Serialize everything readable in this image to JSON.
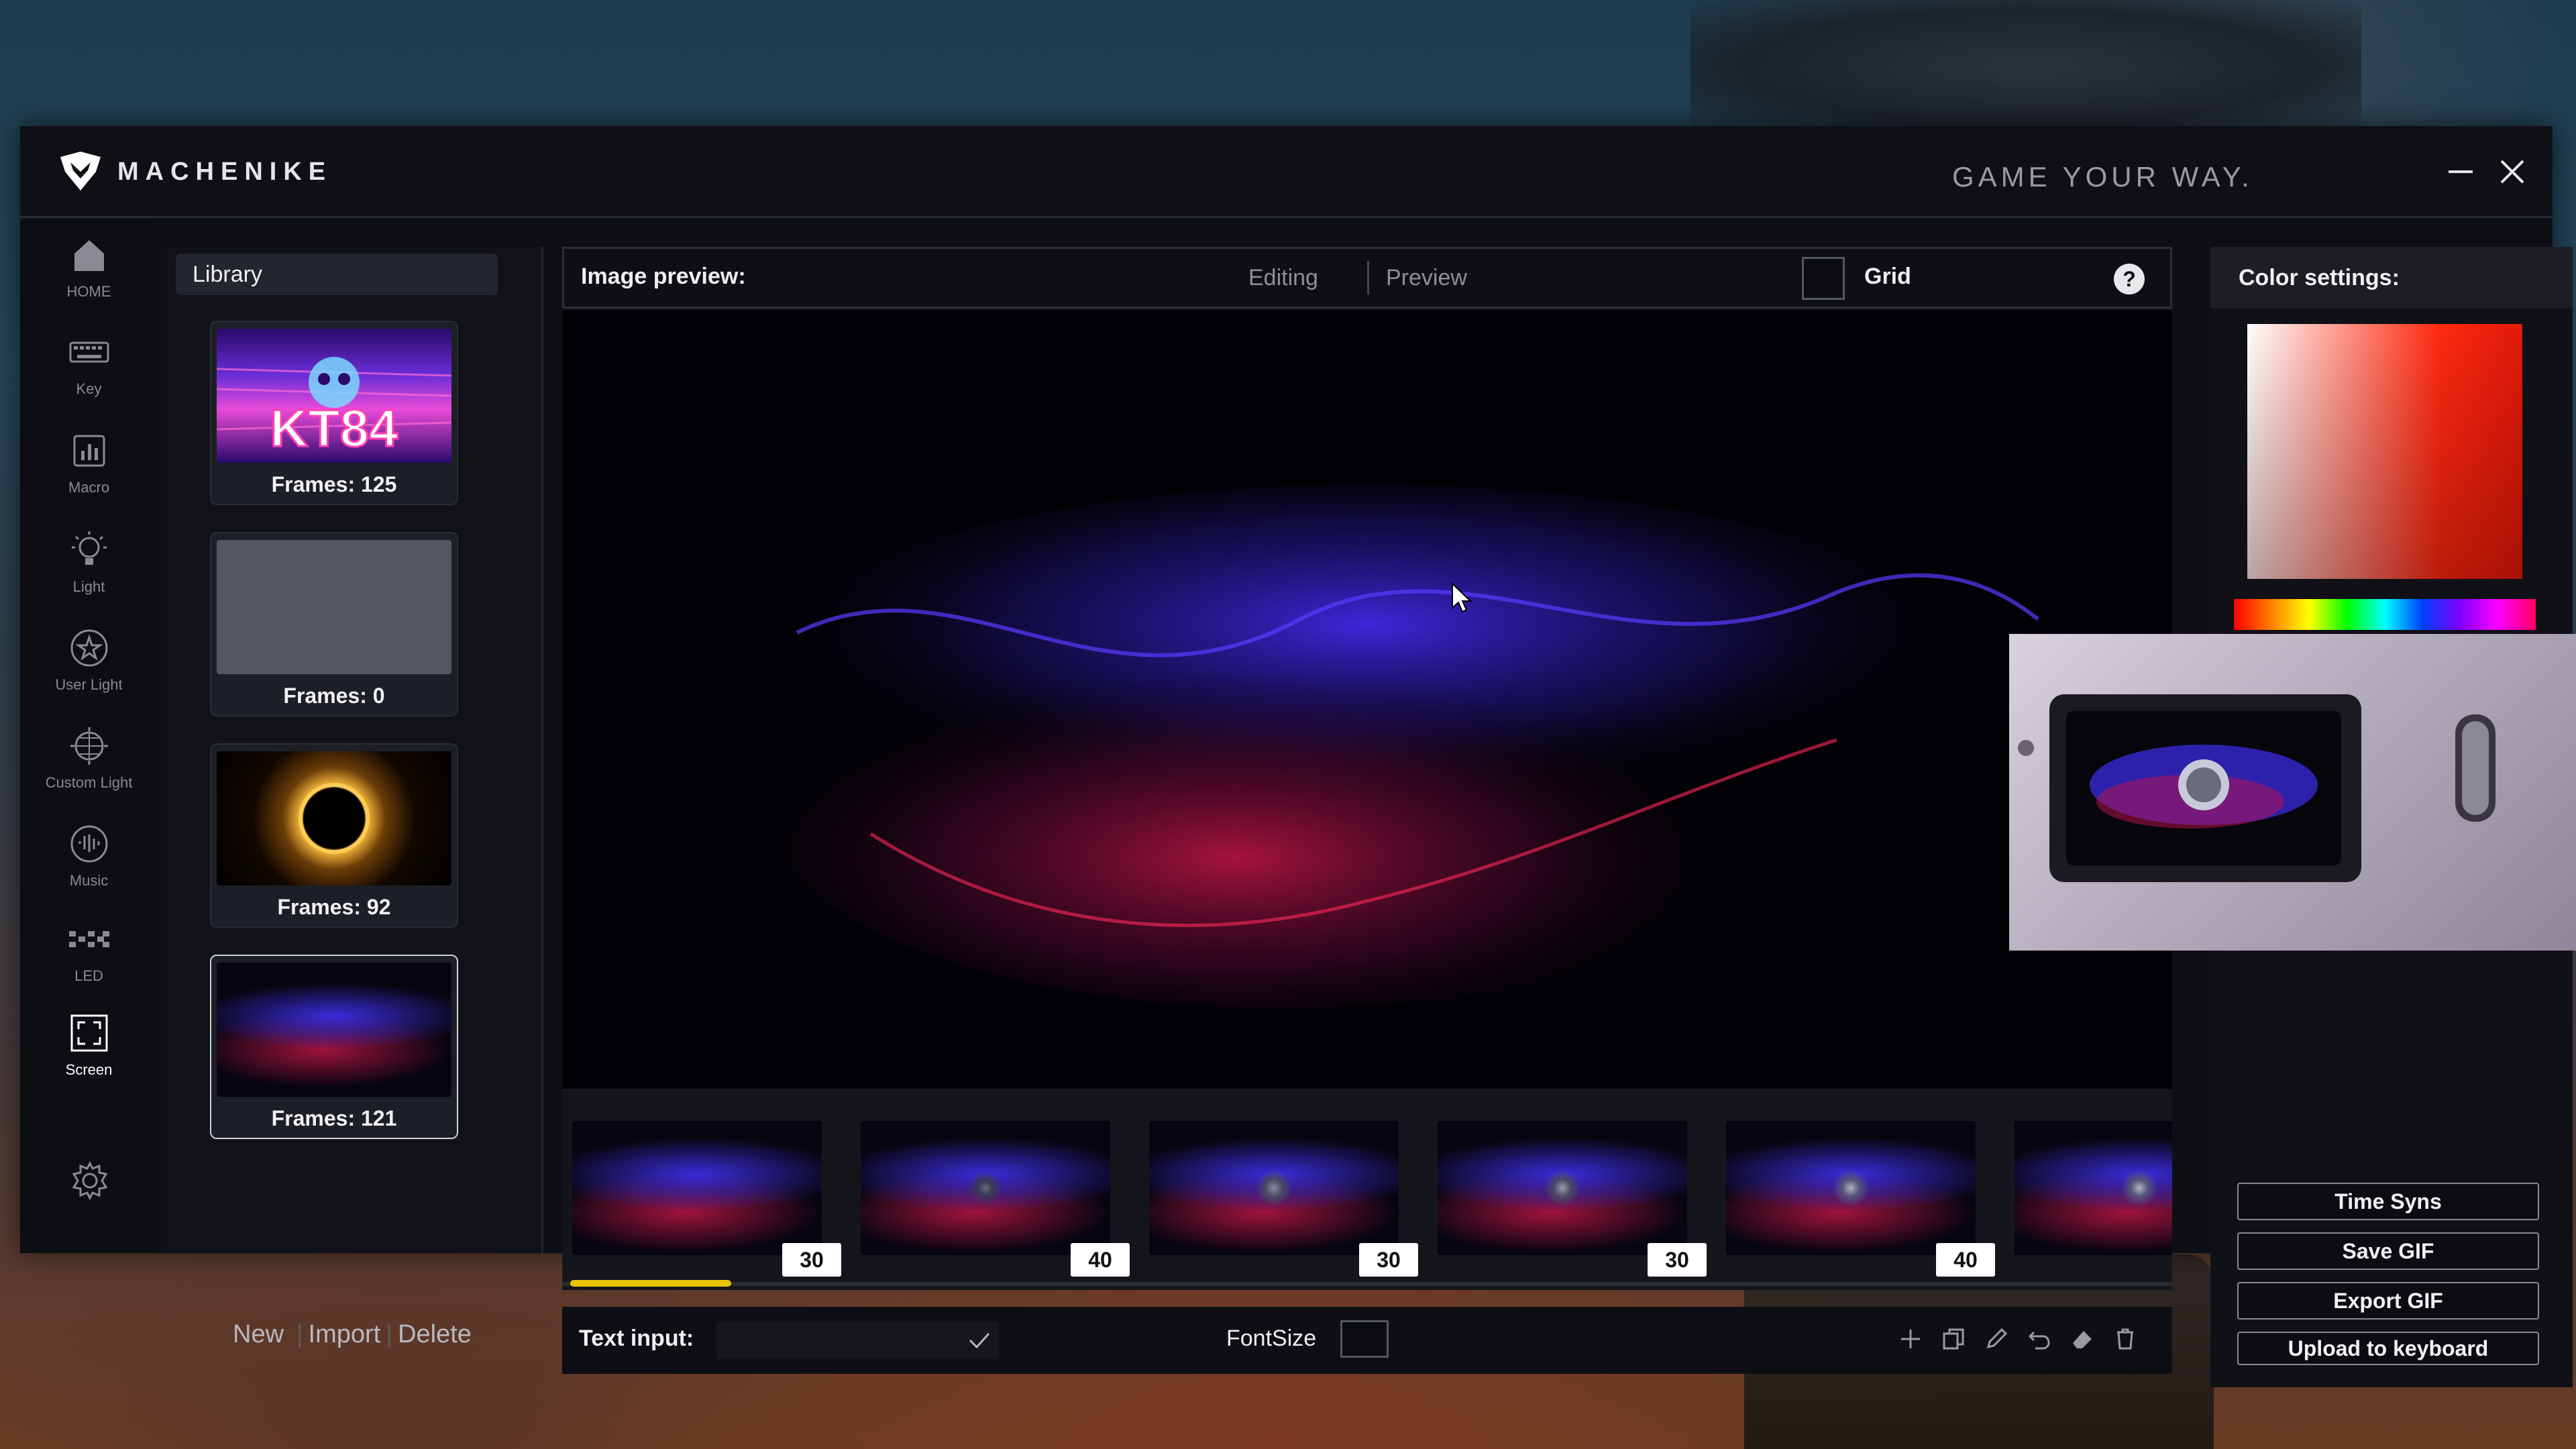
{
  "app": {
    "brand": "MACHENIKE",
    "slogan": "GAME YOUR WAY."
  },
  "nav": {
    "items": [
      {
        "label": "HOME",
        "icon": "home-icon"
      },
      {
        "label": "Key",
        "icon": "keyboard-icon"
      },
      {
        "label": "Macro",
        "icon": "macro-icon"
      },
      {
        "label": "Light",
        "icon": "bulb-icon"
      },
      {
        "label": "User Light",
        "icon": "star-circle-icon"
      },
      {
        "label": "Custom Light",
        "icon": "globe-icon"
      },
      {
        "label": "Music",
        "icon": "music-wave-icon"
      },
      {
        "label": "LED",
        "icon": "led-grid-icon"
      },
      {
        "label": "Screen",
        "icon": "screen-frame-icon"
      }
    ],
    "active": "Screen"
  },
  "library": {
    "title": "Library",
    "items": [
      {
        "label": "Frames: 125",
        "thumb": "kt84-neon"
      },
      {
        "label": "Frames: 0",
        "thumb": "empty"
      },
      {
        "label": "Frames: 92",
        "thumb": "golden-ring"
      },
      {
        "label": "Frames: 121",
        "thumb": "purple-wave"
      }
    ],
    "actions": {
      "new": "New",
      "import": "Import",
      "delete": "Delete"
    }
  },
  "preview": {
    "title": "Image preview:",
    "mode_editing": "Editing",
    "mode_preview": "Preview",
    "grid_label": "Grid",
    "help": "?"
  },
  "timeline": {
    "frames": [
      {
        "duration": "30"
      },
      {
        "duration": "40"
      },
      {
        "duration": "30"
      },
      {
        "duration": "30"
      },
      {
        "duration": "40"
      },
      {
        "duration": ""
      }
    ],
    "progress": 0.04
  },
  "textbar": {
    "text_input_label": "Text input:",
    "text_value": "",
    "fontsize_label": "FontSize"
  },
  "colors": {
    "title": "Color settings:",
    "accent_yellow": "#e6c200",
    "selected_color": "#ff2a10"
  },
  "buttons": {
    "time_sync": "Time Syns",
    "save_gif": "Save GIF",
    "export_gif": "Export GIF",
    "upload": "Upload to keyboard"
  }
}
